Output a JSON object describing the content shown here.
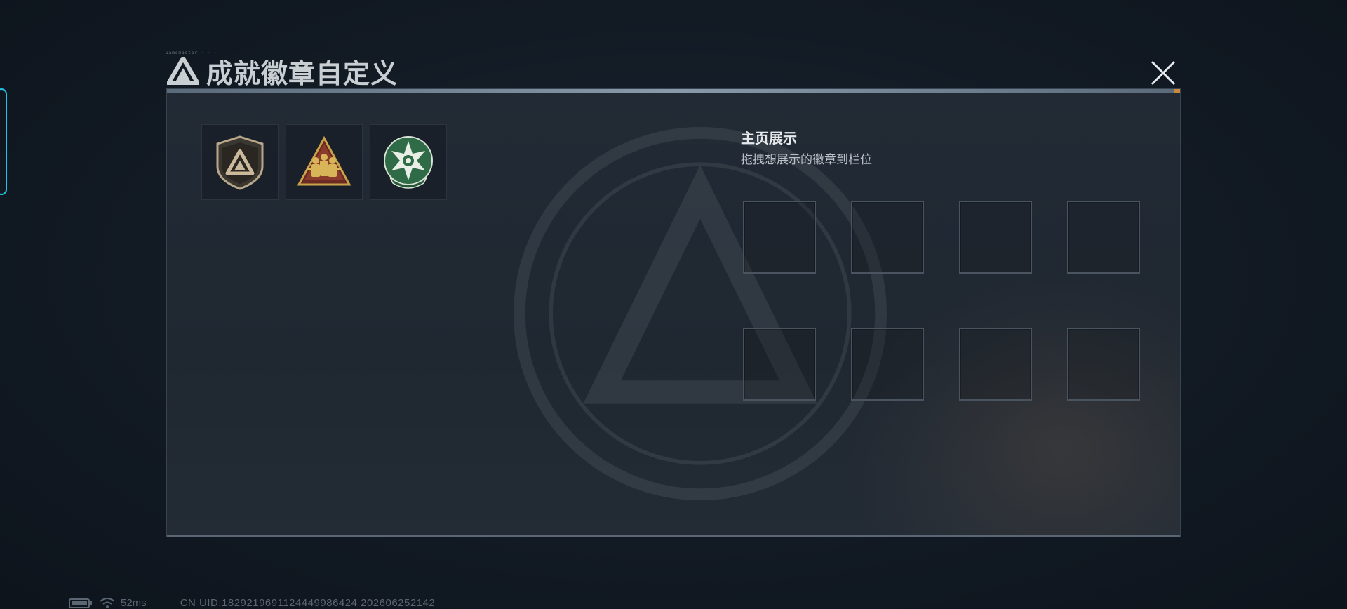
{
  "header": {
    "micro_text": "Gamemaster · · · ·",
    "title": "成就徽章自定义",
    "logo_icon": "triangle-logo-icon",
    "close_icon": "close-icon"
  },
  "badges": [
    {
      "name": "shield-triangle-badge",
      "icon": "shield-triangle-icon"
    },
    {
      "name": "squad-triangle-badge",
      "icon": "squad-triangle-icon"
    },
    {
      "name": "green-star-badge",
      "icon": "green-star-icon"
    }
  ],
  "showcase": {
    "title": "主页展示",
    "subtitle": "拖拽想展示的徽章到栏位",
    "slot_count": 8
  },
  "status": {
    "battery_icon": "battery-icon",
    "wifi_icon": "wifi-icon",
    "ping": "52ms",
    "uid": "CN UID:1829219691124449986424 202606252142"
  },
  "colors": {
    "accent_cyan": "#22c4e6",
    "accent_orange": "#c98a3a",
    "badge_gold": "#c9a24a",
    "badge_green": "#2f6b46"
  }
}
